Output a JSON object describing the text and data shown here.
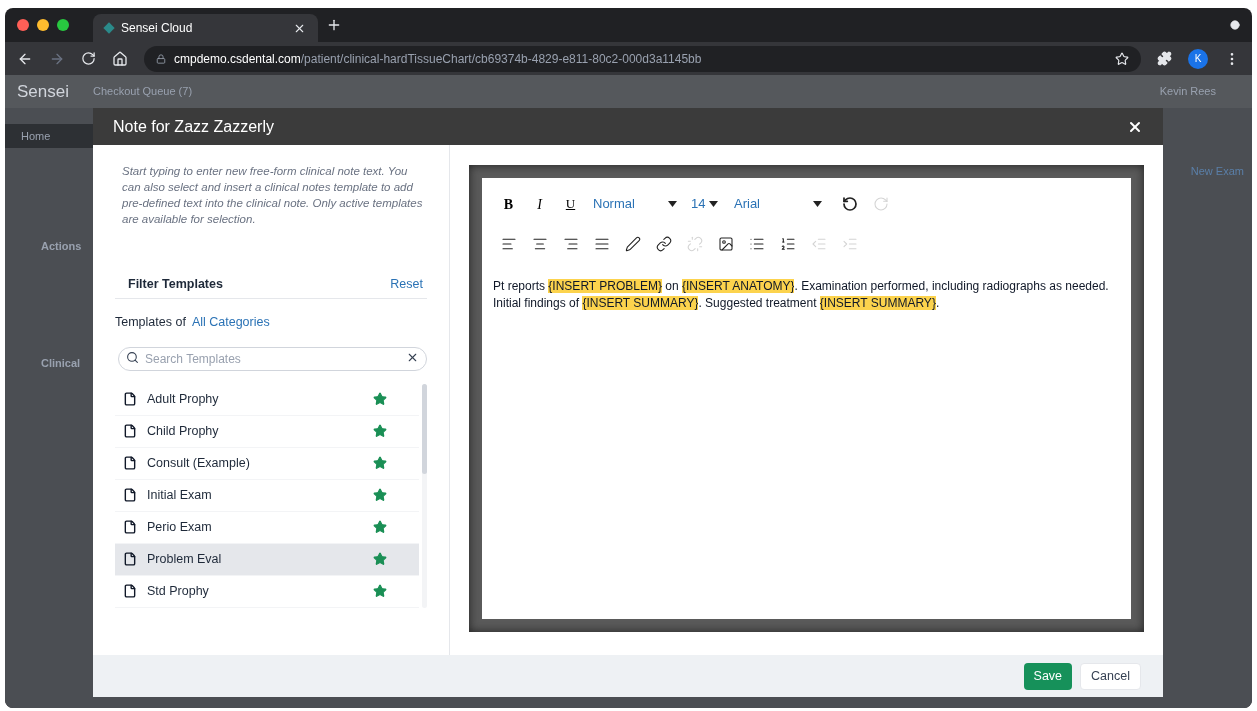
{
  "browser": {
    "tab_title": "Sensei Cloud",
    "url_domain": "cmpdemo.csdental.com",
    "url_path": "/patient/clinical-hardTissueChart/cb69374b-4829-e811-80c2-000d3a1145bb",
    "profile_initial": "K"
  },
  "background": {
    "logo": "Sensei",
    "queue": "Checkout Queue (7)",
    "user": "Kevin Rees",
    "nav_home": "Home",
    "actions": "Actions",
    "clinical": "Clinical",
    "new_exam": "New Exam"
  },
  "modal": {
    "title": "Note for Zazz Zazzerly",
    "instructions": "Start typing to enter new free-form clinical note text. You can also select and insert a clinical notes template to add pre-defined text into the clinical note. Only active templates are available for selection.",
    "filter_label": "Filter Templates",
    "reset": "Reset",
    "templates_of": "Templates of",
    "category": "All Categories",
    "search": {
      "placeholder": "Search Templates"
    },
    "templates": [
      {
        "name": "Adult Prophy",
        "selected": false,
        "starred": true
      },
      {
        "name": "Child Prophy",
        "selected": false,
        "starred": true
      },
      {
        "name": "Consult (Example)",
        "selected": false,
        "starred": true
      },
      {
        "name": "Initial Exam",
        "selected": false,
        "starred": true
      },
      {
        "name": "Perio Exam",
        "selected": false,
        "starred": true
      },
      {
        "name": "Problem Eval",
        "selected": true,
        "starred": true
      },
      {
        "name": "Std Prophy",
        "selected": false,
        "starred": true
      }
    ],
    "editor": {
      "bold": "B",
      "italic": "I",
      "underline": "U",
      "style": "Normal",
      "size": "14",
      "font": "Arial",
      "history": [
        {
          "kind": "undo",
          "disabled": false
        },
        {
          "kind": "redo",
          "disabled": true
        }
      ],
      "tools": [
        {
          "kind": "align-left",
          "disabled": false
        },
        {
          "kind": "align-center",
          "disabled": false
        },
        {
          "kind": "align-right",
          "disabled": false
        },
        {
          "kind": "align-justify",
          "disabled": false
        },
        {
          "kind": "pen",
          "disabled": false
        },
        {
          "kind": "link",
          "disabled": false
        },
        {
          "kind": "unlink",
          "disabled": true
        },
        {
          "kind": "image",
          "disabled": false
        },
        {
          "kind": "bullets",
          "disabled": false
        },
        {
          "kind": "numbers",
          "disabled": false
        },
        {
          "kind": "outdent",
          "disabled": true
        },
        {
          "kind": "indent",
          "disabled": true
        }
      ],
      "segments": [
        {
          "text": "Pt reports ",
          "highlight": false
        },
        {
          "text": "{INSERT PROBLEM}",
          "highlight": true
        },
        {
          "text": " on ",
          "highlight": false
        },
        {
          "text": "{INSERT ANATOMY}",
          "highlight": true
        },
        {
          "text": ". Examination performed, including radiographs as needed. Initial findings of ",
          "highlight": false
        },
        {
          "text": "{INSERT SUMMARY}",
          "highlight": true
        },
        {
          "text": ". Suggested treatment ",
          "highlight": false
        },
        {
          "text": "{INSERT SUMMARY}",
          "highlight": true
        },
        {
          "text": ".",
          "highlight": false
        }
      ]
    },
    "buttons": [
      {
        "label": "Save",
        "kind": "primary"
      },
      {
        "label": "Cancel",
        "kind": "secondary"
      }
    ]
  }
}
